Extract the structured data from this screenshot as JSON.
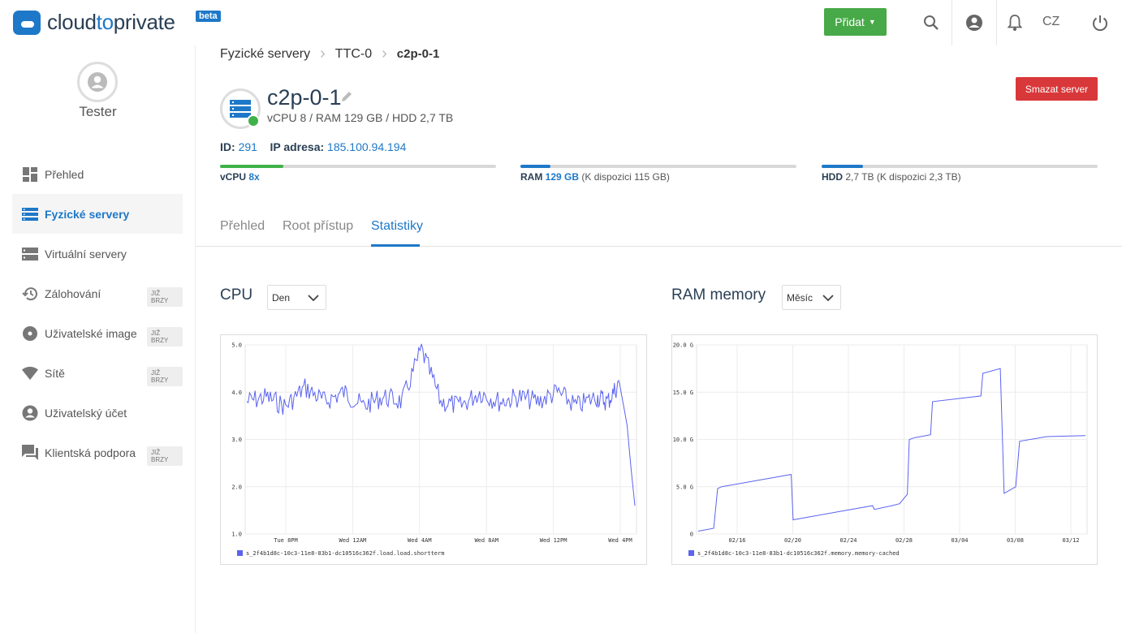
{
  "header": {
    "logo_text_a": "cloud",
    "logo_text_b": "to",
    "logo_text_c": "private",
    "beta_label": "beta",
    "add_label": "Přidat",
    "lang": "CZ"
  },
  "sidebar": {
    "user_name": "Tester",
    "items": [
      {
        "label": "Přehled",
        "icon": "dashboard-icon",
        "soon": ""
      },
      {
        "label": "Fyzické servery",
        "icon": "servers-icon",
        "soon": ""
      },
      {
        "label": "Virtuální servery",
        "icon": "virtual-servers-icon",
        "soon": ""
      },
      {
        "label": "Zálohování",
        "icon": "backup-icon",
        "soon": "JIŽ BRZY"
      },
      {
        "label": "Uživatelské image",
        "icon": "disc-icon",
        "soon": "JIŽ BRZY"
      },
      {
        "label": "Sítě",
        "icon": "wifi-icon",
        "soon": "JIŽ BRZY"
      },
      {
        "label": "Uživatelský účet",
        "icon": "account-icon",
        "soon": ""
      },
      {
        "label": "Klientská podpora",
        "icon": "chat-icon",
        "soon": "JIŽ BRZY"
      }
    ]
  },
  "breadcrumb": [
    "Fyzické servery",
    "TTC-0",
    "c2p-0-1"
  ],
  "server": {
    "name": "c2p-0-1",
    "spec": "vCPU 8 / RAM 129 GB / HDD 2,7 TB",
    "delete_label": "Smazat server",
    "id_label": "ID:",
    "id_value": "291",
    "ip_label": "IP adresa:",
    "ip_value": "185.100.94.194",
    "status_color": "#3fb24a"
  },
  "resources": {
    "vcpu": {
      "label": "vCPU",
      "value": "8x",
      "extra": "",
      "usage": 0.23,
      "color": "#3fb24a"
    },
    "ram": {
      "label": "RAM",
      "value": "129 GB",
      "extra": "(K dispozici 115 GB)",
      "usage": 0.11,
      "color": "#1e78c8"
    },
    "hdd": {
      "label": "HDD",
      "value": "2,7 TB",
      "extra": "(K dispozici 2,3 TB)",
      "usage": 0.15,
      "color": "#1e78c8"
    }
  },
  "tabs": [
    "Přehled",
    "Root přístup",
    "Statistiky"
  ],
  "active_tab": "Statistiky",
  "cpu_panel": {
    "title": "CPU",
    "period": "Den"
  },
  "ram_panel": {
    "title": "RAM memory",
    "period": "Měsíc"
  },
  "chart_data": [
    {
      "type": "line",
      "title": "",
      "ylim": [
        1.0,
        5.0
      ],
      "yticks": [
        "5.0",
        "4.0",
        "3.0",
        "2.0",
        "1.0"
      ],
      "xticks": [
        "Tue  8PM",
        "Wed 12AM",
        "Wed  4AM",
        "Wed  8AM",
        "Wed 12PM",
        "Wed  4PM"
      ],
      "legend": "s_2f4b1d8c-10c3-11e8-83b1-dc10516c362f.load.load.shortterm",
      "series_color": "#5b63f0",
      "x": [
        0,
        0.05,
        0.1,
        0.15,
        0.2,
        0.25,
        0.3,
        0.35,
        0.4,
        0.45,
        0.5,
        0.55,
        0.6,
        0.65,
        0.7,
        0.75,
        0.8,
        0.85,
        0.9,
        0.93,
        0.96,
        0.98,
        0.99,
        1.0
      ],
      "values": [
        3.8,
        3.9,
        3.7,
        4.1,
        3.8,
        4.0,
        3.7,
        3.9,
        3.8,
        4.9,
        3.8,
        3.7,
        4.0,
        3.8,
        3.9,
        3.8,
        4.0,
        3.7,
        3.9,
        3.8,
        4.2,
        3.3,
        2.4,
        1.6
      ]
    },
    {
      "type": "line",
      "title": "",
      "ylim": [
        0,
        20.0
      ],
      "yticks": [
        "20.0 G",
        "15.0 G",
        "10.0 G",
        "5.0 G",
        "0"
      ],
      "xticks": [
        "02/16",
        "02/20",
        "02/24",
        "02/28",
        "03/04",
        "03/08",
        "03/12"
      ],
      "legend": "s_2f4b1d8c-10c3-11e8-83b1-dc10516c362f.memory.memory-cached",
      "series_color": "#5b63f0",
      "x": [
        0.0,
        0.04,
        0.05,
        0.06,
        0.24,
        0.245,
        0.45,
        0.455,
        0.5,
        0.52,
        0.54,
        0.545,
        0.56,
        0.6,
        0.605,
        0.73,
        0.735,
        0.78,
        0.79,
        0.82,
        0.83,
        0.9,
        1.0
      ],
      "values": [
        0.3,
        0.6,
        4.8,
        5.0,
        6.3,
        1.5,
        3.0,
        2.6,
        3.0,
        3.2,
        4.2,
        10.0,
        10.2,
        10.5,
        14.0,
        14.6,
        17.0,
        17.5,
        4.3,
        5.0,
        9.8,
        10.3,
        10.4
      ]
    }
  ]
}
